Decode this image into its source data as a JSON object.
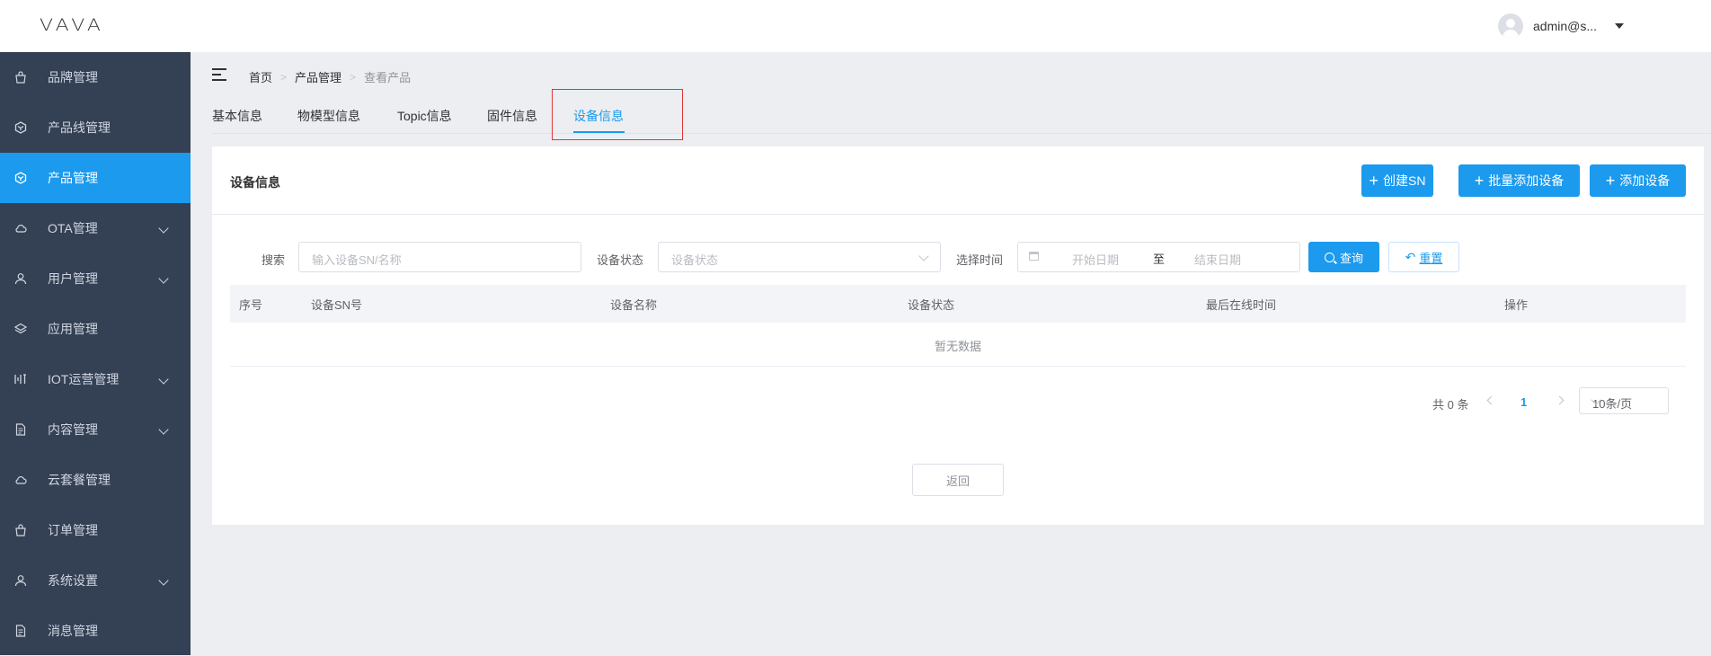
{
  "header": {
    "logo": "VAVA",
    "username": "admin@s..."
  },
  "sidebar": {
    "items": [
      {
        "label": "品牌管理",
        "icon": "bag-icon",
        "has_children": false,
        "active": false
      },
      {
        "label": "产品线管理",
        "icon": "cube-icon",
        "has_children": false,
        "active": false
      },
      {
        "label": "产品管理",
        "icon": "cube-icon",
        "has_children": false,
        "active": true
      },
      {
        "label": "OTA管理",
        "icon": "cloud-icon",
        "has_children": true,
        "active": false
      },
      {
        "label": "用户管理",
        "icon": "user-icon",
        "has_children": true,
        "active": false
      },
      {
        "label": "应用管理",
        "icon": "layers-icon",
        "has_children": false,
        "active": false
      },
      {
        "label": "IOT运营管理",
        "icon": "iot-icon",
        "has_children": true,
        "active": false
      },
      {
        "label": "内容管理",
        "icon": "document-icon",
        "has_children": true,
        "active": false
      },
      {
        "label": "云套餐管理",
        "icon": "cloud-icon",
        "has_children": false,
        "active": false
      },
      {
        "label": "订单管理",
        "icon": "bag-icon",
        "has_children": false,
        "active": false
      },
      {
        "label": "系统设置",
        "icon": "user-icon",
        "has_children": true,
        "active": false
      },
      {
        "label": "消息管理",
        "icon": "document-icon",
        "has_children": false,
        "active": false
      }
    ]
  },
  "breadcrumb": {
    "home": "首页",
    "parent": "产品管理",
    "current": "查看产品",
    "separator": ">"
  },
  "tabs": [
    "基本信息",
    "物模型信息",
    "Topic信息",
    "固件信息",
    "设备信息"
  ],
  "active_tab": "设备信息",
  "card": {
    "title": "设备信息",
    "buttons": {
      "create_sn": "创建SN",
      "batch_add": "批量添加设备",
      "add_device": "添加设备"
    }
  },
  "filters": {
    "search_label": "搜索",
    "search_placeholder": "输入设备SN/名称",
    "status_label": "设备状态",
    "status_placeholder": "设备状态",
    "time_label": "选择时间",
    "start_placeholder": "开始日期",
    "range_separator": "至",
    "end_placeholder": "结束日期",
    "query_button": "查询",
    "reset_button": "重置"
  },
  "table": {
    "columns": [
      "序号",
      "设备SN号",
      "设备名称",
      "设备状态",
      "最后在线时间",
      "操作"
    ],
    "empty_text": "暂无数据"
  },
  "pagination": {
    "total_text": "共 0 条",
    "current_page": "1",
    "page_size": "10条/页"
  },
  "back_button": "返回",
  "colors": {
    "primary": "#1b9aee",
    "sidebar": "#344054",
    "highlight": "#e0353a"
  }
}
